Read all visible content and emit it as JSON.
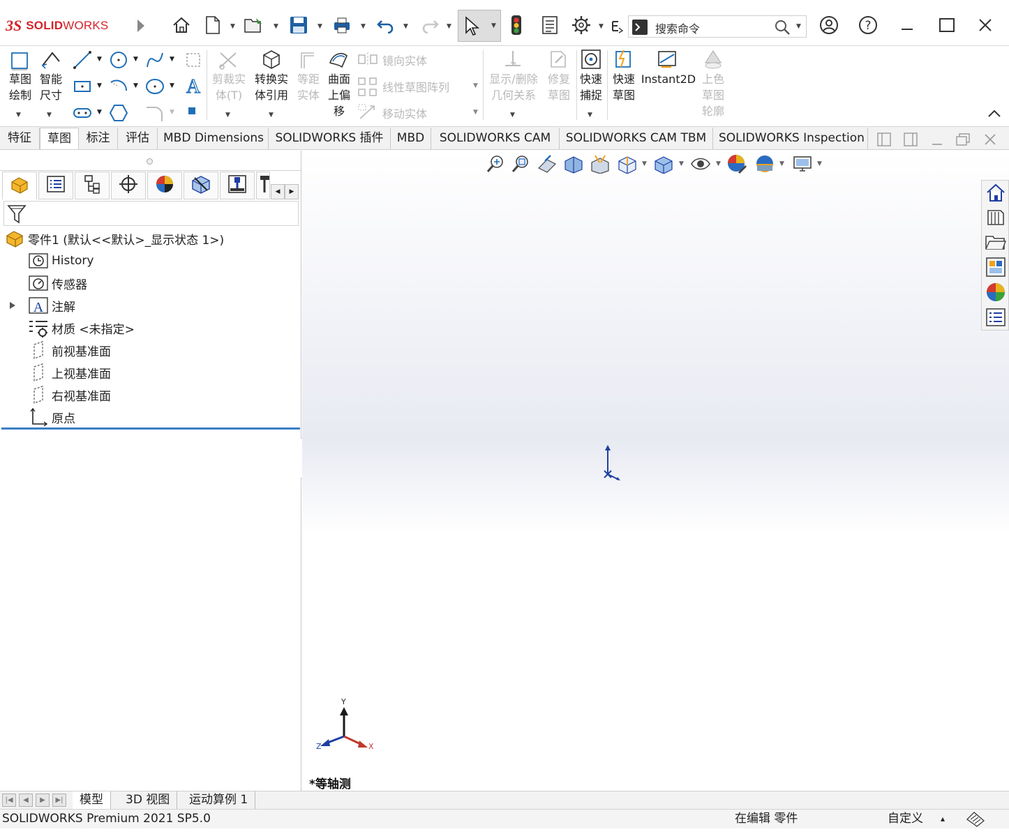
{
  "titlebar": {
    "logo_ds": "3S",
    "logo_text_bold": "SOLID",
    "logo_text": "WORKS",
    "search_placeholder": "搜索命令",
    "icons": [
      "home-icon",
      "new-document-icon",
      "open-icon",
      "save-icon",
      "print-icon",
      "undo-icon",
      "redo-icon",
      "select-icon",
      "rebuild-icon",
      "file-properties-icon",
      "options-icon",
      "search-icon",
      "user-icon",
      "help-icon",
      "minimize-icon",
      "maximize-icon",
      "close-icon"
    ]
  },
  "ribbon": {
    "sketch": "草图\n绘制",
    "smart_dim": "智能\n尺寸",
    "trim": "剪裁实\n体(T)",
    "convert": "转换实\n体引用",
    "offset": "等距\n实体",
    "surface_offset": "曲面\n上偏\n移",
    "mirror": "镜向实体",
    "linear_pattern": "线性草图阵列",
    "move": "移动实体",
    "relations": "显示/删除\n几何关系",
    "repair": "修复\n草图",
    "quick_snap": "快速\n捕捉",
    "rapid_sketch": "快速\n草图",
    "instant2d": "Instant2D",
    "shaded_contour": "上色\n草图\n轮廓"
  },
  "tabs": [
    "特征",
    "草图",
    "标注",
    "评估",
    "MBD Dimensions",
    "SOLIDWORKS 插件",
    "MBD",
    "SOLIDWORKS CAM",
    "SOLIDWORKS CAM TBM",
    "SOLIDWORKS Inspection"
  ],
  "active_tab": "草图",
  "tree": {
    "root": "零件1  (默认<<默认>_显示状态 1>)",
    "items": [
      "History",
      "传感器",
      "注解",
      "材质 <未指定>",
      "前视基准面",
      "上视基准面",
      "右视基准面",
      "原点"
    ]
  },
  "viewport": {
    "view_label": "*等轴测",
    "triad": {
      "y": "Y",
      "x": "X",
      "z": "Z"
    }
  },
  "bottom_tabs": [
    "模型",
    "3D 视图",
    "运动算例 1"
  ],
  "status": {
    "product": "SOLIDWORKS Premium 2021 SP5.0",
    "editing": "在编辑 零件",
    "units": "自定义",
    "caret": "▴"
  },
  "colors": {
    "brand": "#d4242b",
    "accent_blue": "#1f6fb8",
    "tree_separator": "#3c7fc4",
    "triad_y": "#1a1a1a",
    "triad_x": "#c0392b",
    "triad_z": "#1f3fa0"
  }
}
